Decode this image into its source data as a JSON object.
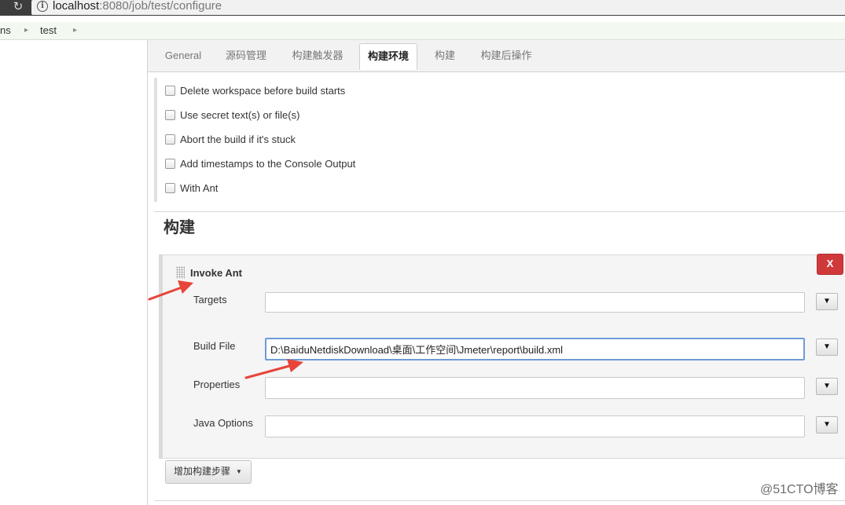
{
  "browser": {
    "url_host": "localhost",
    "url_rest": ":8080/job/test/configure"
  },
  "breadcrumb": {
    "items": [
      "ns",
      "test"
    ],
    "separator": "▸"
  },
  "tabs": [
    {
      "label": "General",
      "active": false
    },
    {
      "label": "源码管理",
      "active": false
    },
    {
      "label": "构建触发器",
      "active": false
    },
    {
      "label": "构建环境",
      "active": true
    },
    {
      "label": "构建",
      "active": false
    },
    {
      "label": "构建后操作",
      "active": false
    }
  ],
  "build_environment": {
    "options": [
      {
        "label": "Delete workspace before build starts",
        "checked": false
      },
      {
        "label": "Use secret text(s) or file(s)",
        "checked": false
      },
      {
        "label": "Abort the build if it's stuck",
        "checked": false
      },
      {
        "label": "Add timestamps to the Console Output",
        "checked": false
      },
      {
        "label": "With Ant",
        "checked": false
      }
    ]
  },
  "build": {
    "section_title": "构建",
    "step": {
      "title": "Invoke Ant",
      "delete_label": "X",
      "fields": [
        {
          "label": "Targets",
          "value": ""
        },
        {
          "label": "Build File",
          "value": "D:\\BaiduNetdiskDownload\\桌面\\工作空间\\Jmeter\\report\\build.xml"
        },
        {
          "label": "Properties",
          "value": ""
        },
        {
          "label": "Java Options",
          "value": ""
        }
      ],
      "expand_glyph": "▼"
    },
    "add_step_label": "增加构建步骤",
    "add_step_caret": "▼"
  },
  "colors": {
    "annotation_arrow": "#e8443a",
    "delete_button": "#d0393a",
    "focus_border": "#6f9bd6"
  },
  "watermark": "@51CTO博客"
}
